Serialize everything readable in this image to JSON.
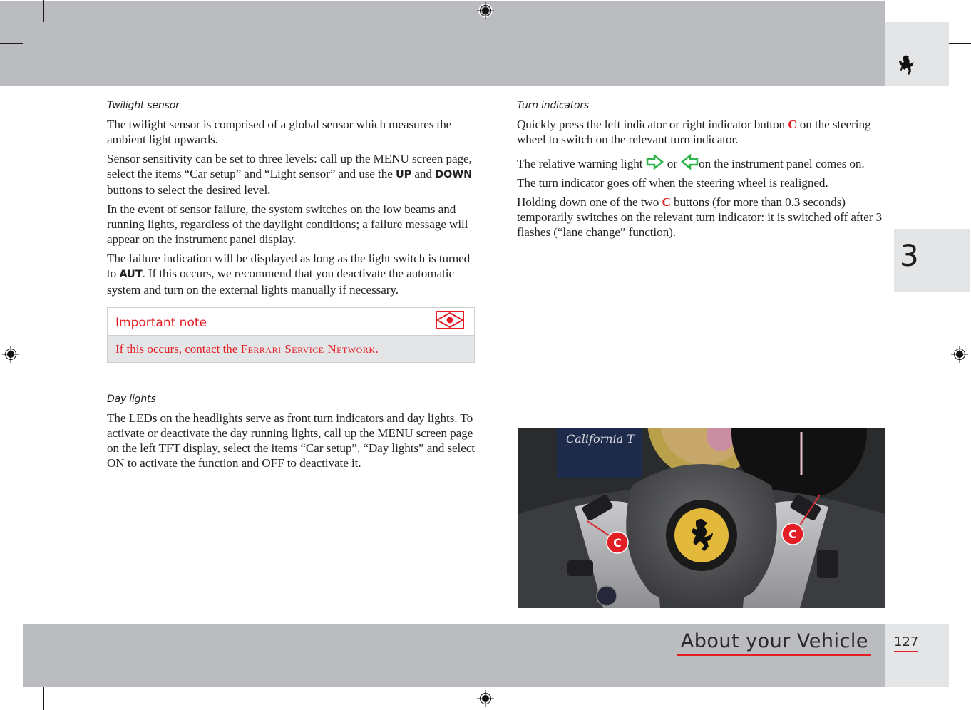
{
  "header": {
    "logo_icon": "prancing-horse-icon"
  },
  "chapter_tab": {
    "number": "3"
  },
  "footer": {
    "section_title": "About your Vehicle",
    "page_number": "127",
    "accent_color": "#e31e24"
  },
  "left_column": {
    "twilight": {
      "heading": "Twilight sensor",
      "p1": "The twilight sensor is comprised of a global sensor which measures the ambient light upwards.",
      "p2_a": "Sensor sensitivity can be set to three levels: call up the MENU screen page, select the items “Car setup” and “Light sensor” and use the ",
      "p2_up": "UP",
      "p2_and": " and ",
      "p2_down": "DOWN",
      "p2_b": " buttons to select the desired level.",
      "p3": "In the event of sensor failure, the system switches on the low beams and running lights, regardless of the daylight conditions; a failure message will appear on the instrument panel display.",
      "p4_a": "The failure indication will be displayed as long as the light switch is turned to ",
      "p4_aut": "AUT",
      "p4_b": ". If this occurs, we recommend that you deactivate the automatic system and turn on the external lights manually if necessary."
    },
    "note": {
      "title": "Important note",
      "icon": "eye-warning-icon",
      "text_a": "If this occurs, contact the ",
      "text_network": "Ferrari Service Network",
      "text_b": "."
    },
    "day_lights": {
      "heading": "Day lights",
      "p1": "The LEDs on the headlights serve as front turn indicators and day lights. To activate or deactivate the day running lights, call up the MENU screen page on the left TFT display, select the items “Car setup”, “Day lights” and select ON to activate the function and OFF to deactivate it."
    }
  },
  "right_column": {
    "turn": {
      "heading": "Turn indicators",
      "p1_a": "Quickly press the left indicator or right indicator button ",
      "p1_c": "C",
      "p1_b": " on the steering wheel to switch on the relevant turn indicator.",
      "p2_a": "The relative warning light ",
      "p2_or": " or ",
      "p2_b": "on the instrument panel comes on.",
      "p3": "The turn indicator goes off when the steering wheel is realigned.",
      "p4_a": "Holding down one of the two ",
      "p4_c": "C",
      "p4_b": " buttons (for more than 0.3 seconds) temporarily switches on the relevant turn indicator: it is switched off after 3 flashes (“lane change” function).",
      "indicator_color": "#2fb34a"
    },
    "photo": {
      "display_text": "California T",
      "callout_left": "C",
      "callout_right": "C"
    }
  }
}
